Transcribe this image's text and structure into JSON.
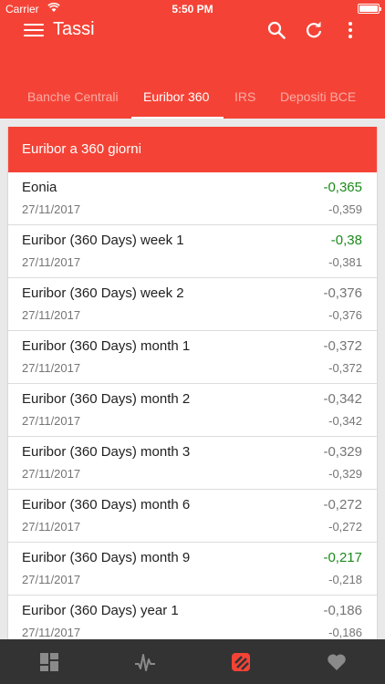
{
  "status_bar": {
    "carrier": "Carrier",
    "time": "5:50 PM",
    "wifi_icon": "wifi-icon",
    "battery_icon": "battery-full-icon"
  },
  "app_bar": {
    "title": "Tassi",
    "icons": [
      "menu-icon",
      "search-icon",
      "refresh-icon",
      "more-vertical-icon"
    ]
  },
  "tabs": [
    {
      "label": "Banche Centrali",
      "active": false
    },
    {
      "label": "Euribor 360",
      "active": true
    },
    {
      "label": "IRS",
      "active": false
    },
    {
      "label": "Depositi BCE",
      "active": false
    }
  ],
  "card": {
    "title": "Euribor a 360 giorni",
    "rows": [
      {
        "name": "Eonia",
        "date": "27/11/2017",
        "value": "-0,365",
        "prev": "-0,359",
        "trend": "up"
      },
      {
        "name": "Euribor (360 Days) week 1",
        "date": "27/11/2017",
        "value": "-0,38",
        "prev": "-0,381",
        "trend": "up"
      },
      {
        "name": "Euribor (360 Days) week 2",
        "date": "27/11/2017",
        "value": "-0,376",
        "prev": "-0,376",
        "trend": "flat"
      },
      {
        "name": "Euribor (360 Days) month 1",
        "date": "27/11/2017",
        "value": "-0,372",
        "prev": "-0,372",
        "trend": "flat"
      },
      {
        "name": "Euribor (360 Days) month 2",
        "date": "27/11/2017",
        "value": "-0,342",
        "prev": "-0,342",
        "trend": "flat"
      },
      {
        "name": "Euribor (360 Days) month 3",
        "date": "27/11/2017",
        "value": "-0,329",
        "prev": "-0,329",
        "trend": "flat"
      },
      {
        "name": "Euribor (360 Days) month 6",
        "date": "27/11/2017",
        "value": "-0,272",
        "prev": "-0,272",
        "trend": "flat"
      },
      {
        "name": "Euribor (360 Days) month 9",
        "date": "27/11/2017",
        "value": "-0,217",
        "prev": "-0,218",
        "trend": "up"
      },
      {
        "name": "Euribor (360 Days) year 1",
        "date": "27/11/2017",
        "value": "-0,186",
        "prev": "-0,186",
        "trend": "flat"
      }
    ]
  },
  "bottom_nav": {
    "items": [
      "dashboard-icon",
      "pulse-chart-icon",
      "rates-icon",
      "heart-icon"
    ],
    "active": "rates-icon"
  },
  "colors": {
    "primary": "#f44336",
    "positive": "#1b8a1b",
    "neutral": "#757575",
    "nav_background": "#333333",
    "content_background": "#e9e9e9"
  }
}
